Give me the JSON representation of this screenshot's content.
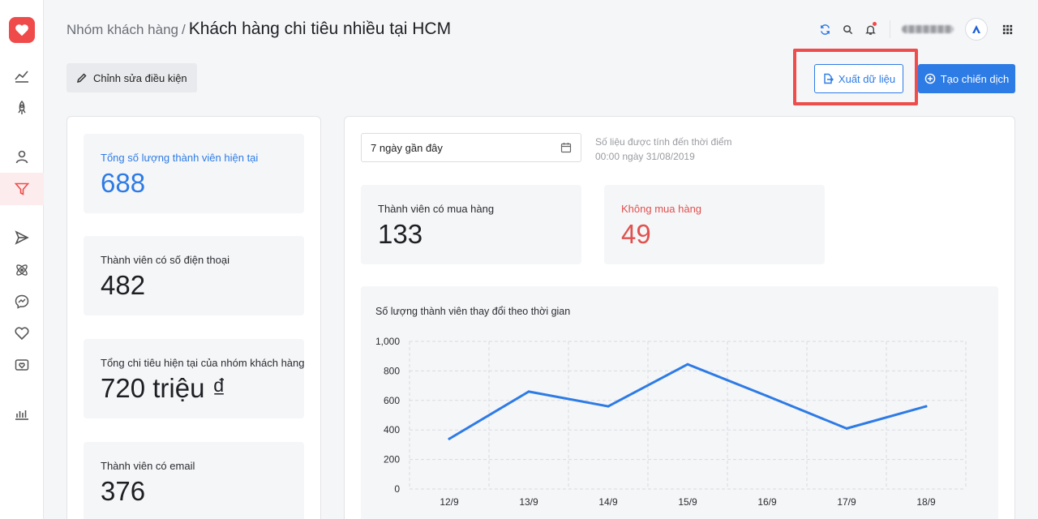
{
  "breadcrumb": {
    "parent": "Nhóm khách hàng",
    "separator": "/",
    "current": "Khách hàng chi tiêu nhiều tại HCM"
  },
  "header": {
    "icons": [
      "sync-icon",
      "search-icon",
      "bell-icon",
      "apps-grid-icon"
    ],
    "notification_dot_color": "#ef4b4b"
  },
  "toolbar": {
    "edit_label": "Chỉnh sửa điều kiện",
    "export_label": "Xuất dữ liệu",
    "create_label": "Tạo chiến dịch",
    "primary_color": "#2d7be5",
    "highlight_color": "#ef4c4c"
  },
  "sidebar": {
    "items": [
      "analytics-icon",
      "rocket-icon",
      "user-icon",
      "funnel-icon",
      "send-icon",
      "atom-icon",
      "messenger-icon",
      "heart-icon",
      "camera-heart-icon",
      "bar-chart-icon"
    ],
    "active": "funnel-icon"
  },
  "stats": {
    "total_members": {
      "label": "Tổng số lượng thành viên hiện tại",
      "value": "688"
    },
    "with_phone": {
      "label": "Thành viên có số điện thoại",
      "value": "482"
    },
    "total_spend": {
      "label": "Tổng chi tiêu hiện tại của nhóm khách hàng",
      "value": "720 triệu ₫"
    },
    "with_email": {
      "label": "Thành viên có email",
      "value": "376"
    }
  },
  "filter": {
    "date_range": "7 ngày gần đây",
    "note_line1": "Số liệu được tính đến thời điểm",
    "note_line2": "00:00 ngày 31/08/2019"
  },
  "purchase": {
    "buyers": {
      "label": "Thành viên có mua hàng",
      "value": "133"
    },
    "non_buyers": {
      "label": "Không mua hàng",
      "value": "49"
    }
  },
  "chart_data": {
    "type": "line",
    "title": "Số lượng thành viên thay đổi theo thời gian",
    "categories": [
      "12/9",
      "13/9",
      "14/9",
      "15/9",
      "16/9",
      "17/9",
      "18/9"
    ],
    "series": [
      {
        "values": [
          340,
          660,
          560,
          845,
          630,
          410,
          560
        ]
      }
    ],
    "y_ticks": [
      "0",
      "200",
      "400",
      "600",
      "800",
      "1,000"
    ],
    "y_tick_values": [
      0,
      200,
      400,
      600,
      800,
      1000
    ],
    "ylim": [
      0,
      1000
    ],
    "grid": "dashed",
    "line_color": "#2d7be5"
  }
}
